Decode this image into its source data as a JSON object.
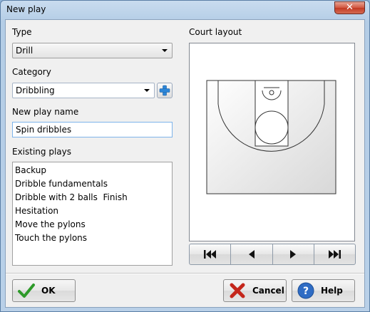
{
  "window": {
    "title": "New play",
    "close_glyph": "✕"
  },
  "type": {
    "label": "Type",
    "value": "Drill"
  },
  "category": {
    "label": "Category",
    "value": "Dribbling",
    "add_icon": "plus-icon"
  },
  "name": {
    "label": "New play name",
    "value": "Spin dribbles"
  },
  "existing": {
    "label": "Existing plays",
    "items": [
      "Backup",
      "Dribble fundamentals",
      "Dribble with 2 balls  Finish",
      "Hesitation",
      "Move the pylons",
      "Touch the pylons"
    ]
  },
  "court": {
    "label": "Court layout"
  },
  "nav": {
    "icons": [
      "skip-first-icon",
      "step-back-icon",
      "step-forward-icon",
      "skip-last-icon"
    ]
  },
  "buttons": {
    "ok_label": "OK",
    "cancel_label": "Cancel",
    "help_label": "Help"
  },
  "colors": {
    "ok_check": "#2e9a2a",
    "cancel_x": "#c4261b",
    "help_circle": "#2f6cc4",
    "plus": "#2d86d8"
  }
}
